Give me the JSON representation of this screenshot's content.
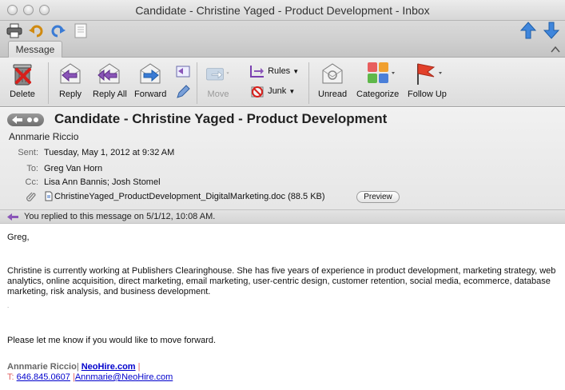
{
  "window": {
    "title": "Candidate - Christine Yaged - Product Development - Inbox"
  },
  "ribbon": {
    "tab": "Message",
    "delete": "Delete",
    "reply": "Reply",
    "reply_all": "Reply All",
    "forward": "Forward",
    "move": "Move",
    "rules": "Rules",
    "junk": "Junk",
    "unread": "Unread",
    "categorize": "Categorize",
    "follow_up": "Follow Up"
  },
  "header": {
    "subject": "Candidate - Christine Yaged - Product Development",
    "sender": "Annmarie Riccio",
    "sent_label": "Sent:",
    "sent_value": "Tuesday, May 1, 2012 at 9:32 AM",
    "to_label": "To:",
    "to_value": "Greg Van Horn",
    "cc_label": "Cc:",
    "cc_value": "Lisa Ann Bannis;  Josh Stomel",
    "attachment": "ChristineYaged_ProductDevelopment_DigitalMarketing.doc (88.5 KB)",
    "preview": "Preview"
  },
  "banner": {
    "replied": "You replied to this message on 5/1/12, 10:08 AM."
  },
  "body": {
    "greeting": "Greg,",
    "para1_line1": "Christine is currently working at Publishers Clearinghouse.  She  has five years of experience in product development, marketing strategy, web",
    "para1_line2": "analytics, online acquisition,  direct marketing, email marketing, user-centric design, customer retention, social media, ecommerce, database",
    "para1_line3": "marketing, risk analysis, and business development.",
    "dot": ".",
    "para2": "Please let me know if you would like to move forward.",
    "sig_name": "Annmarie Riccio",
    "sig_sep1": "| ",
    "sig_company": "NeoHire.com",
    "sig_sep2": " |",
    "sig_t_label": "T: ",
    "sig_phone": "646.845.0607",
    "sig_sep3": " |",
    "sig_email": "Annmarie@NeoHire.com"
  },
  "colors": {
    "link": "#0000cc",
    "accent_purple": "#8a55b8"
  }
}
